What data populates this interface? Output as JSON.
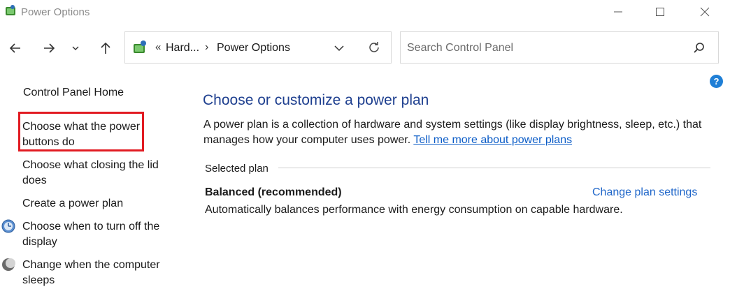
{
  "window": {
    "title": "Power Options",
    "icon": "power-options-icon"
  },
  "navigation": {
    "back_icon": "arrow-left-icon",
    "forward_icon": "arrow-right-icon",
    "recent_icon": "chevron-down-icon",
    "up_icon": "arrow-up-icon"
  },
  "address_bar": {
    "overflow": "«",
    "crumbs": [
      "Hard...",
      "Power Options"
    ],
    "separator": "›"
  },
  "search": {
    "placeholder": "Search Control Panel"
  },
  "help": {
    "label": "?"
  },
  "sidebar": {
    "home": "Control Panel Home",
    "items": [
      {
        "line1": "Choose what the power",
        "line2": "buttons do",
        "highlighted": true
      },
      {
        "line1": "Choose what closing the lid",
        "line2": "does"
      },
      {
        "line1": "Create a power plan"
      },
      {
        "line1": "Choose when to turn off the",
        "line2": "display",
        "icon": "display-icon"
      },
      {
        "line1": "Change when the computer",
        "line2": "sleeps",
        "icon": "sleep-moon-icon"
      }
    ]
  },
  "main": {
    "heading": "Choose or customize a power plan",
    "description": "A power plan is a collection of hardware and system settings (like display brightness, sleep, etc.) that manages how your computer uses power.",
    "learn_more": "Tell me more about power plans",
    "selected_plan_label": "Selected plan",
    "plan": {
      "name": "Balanced (recommended)",
      "change_link": "Change plan settings",
      "description": "Automatically balances performance with energy consumption on capable hardware."
    }
  },
  "colors": {
    "heading": "#1e3f8f",
    "link": "#0b5cc7",
    "highlight_box": "#e11b22"
  }
}
